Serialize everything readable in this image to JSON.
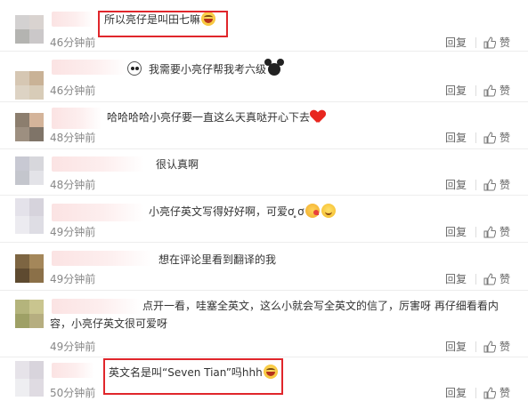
{
  "comments": [
    {
      "text": "所以亮仔是叫田七嘛",
      "trailing_emoji": [
        "laugh-emoji"
      ],
      "time": "46分钟前",
      "avatar_colors": [
        "#d3d1d1",
        "#d9d3d0",
        "#b4b4b1",
        "#cbc8c9"
      ],
      "highlighted": true
    },
    {
      "text": "我需要小亮仔帮我考六级",
      "leading_emoji": [
        "panda-emoji"
      ],
      "trailing_emoji": [
        "mickey-emoji"
      ],
      "time": "46分钟前",
      "avatar_colors": [
        "#d6c7b3",
        "#c9b296",
        "#ddd3c4",
        "#d8ccb8"
      ],
      "highlighted": false
    },
    {
      "text": "哈哈哈哈小亮仔要一直这么天真哒开心下去",
      "trailing_emoji": [
        "heart-emoji"
      ],
      "time": "48分钟前",
      "avatar_colors": [
        "#8c7e6e",
        "#d4b49a",
        "#9d8f80",
        "#7f7468"
      ],
      "highlighted": false
    },
    {
      "text": "很认真啊",
      "time": "48分钟前",
      "avatar_colors": [
        "#c8c9d3",
        "#d7d7dc",
        "#c4c6cd",
        "#e3e3e8"
      ],
      "highlighted": false
    },
    {
      "text": "小亮仔英文写得好好啊，可爱ơ ̥ơ",
      "trailing_emoji": [
        "kiss-emoji",
        "smile-emoji"
      ],
      "time": "49分钟前",
      "avatar_colors": [
        "#e4e2ea",
        "#d6d3dc",
        "#ecebf0",
        "#dedde4"
      ],
      "highlighted": false
    },
    {
      "text": "想在评论里看到翻译的我",
      "time": "49分钟前",
      "avatar_colors": [
        "#7d6542",
        "#a4875a",
        "#5e4a30",
        "#8b7048"
      ],
      "highlighted": false
    },
    {
      "text": "点开一看，哇塞全英文，这么小就会写全英文的信了，厉害呀 再仔细看看内容，小亮仔英文很可爱呀",
      "time": "49分钟前",
      "avatar_colors": [
        "#b4b47c",
        "#c9c58f",
        "#9ea066",
        "#b6ae80"
      ],
      "highlighted": false
    },
    {
      "text": "英文名是叫“Seven Tian”吗hhh",
      "trailing_emoji": [
        "laugh-emoji"
      ],
      "time": "50分钟前",
      "avatar_colors": [
        "#e6e3e9",
        "#d8d4dc",
        "#eeeef1",
        "#dfdbe2"
      ],
      "highlighted": true
    }
  ],
  "actions": {
    "reply_label": "回复",
    "like_label": "赞"
  },
  "colors": {
    "highlight_border": "#e0262b",
    "time_text": "#888888",
    "comment_text": "#333333",
    "action_text": "#666666",
    "divider": "#ededed"
  }
}
